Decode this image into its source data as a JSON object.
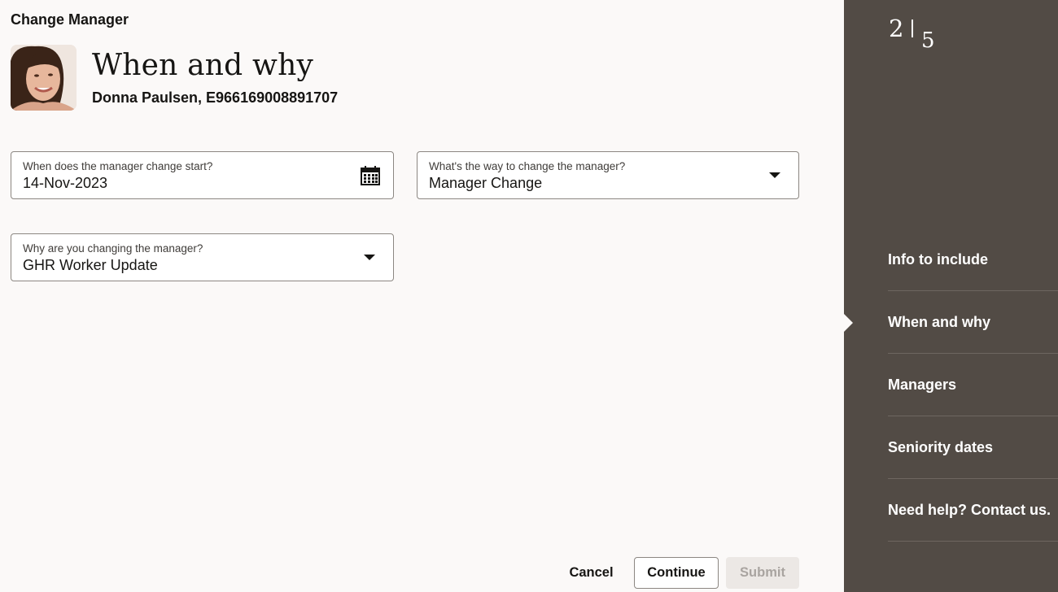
{
  "app": {
    "title": "Change Manager"
  },
  "header": {
    "heading": "When and why",
    "person": "Donna Paulsen, E966169008891707"
  },
  "form": {
    "start_date": {
      "label": "When does the manager change start?",
      "value": "14-Nov-2023",
      "icon": "calendar-icon"
    },
    "change_way": {
      "label": "What's the way to change the manager?",
      "value": "Manager Change",
      "icon": "chevron-down-icon"
    },
    "reason": {
      "label": "Why are you changing the manager?",
      "value": "GHR Worker Update",
      "icon": "chevron-down-icon"
    }
  },
  "actions": {
    "cancel": "Cancel",
    "continue": "Continue",
    "submit": "Submit"
  },
  "progress": {
    "current": "2",
    "total": "5"
  },
  "sidebar": {
    "items": [
      {
        "label": "Info to include"
      },
      {
        "label": "When and why"
      },
      {
        "label": "Managers"
      },
      {
        "label": "Seniority dates"
      },
      {
        "label": "Need help? Contact us."
      }
    ],
    "active_index": 1
  },
  "colors": {
    "sidebar_bg": "#524b45",
    "page_bg": "#fbf9f8",
    "field_border": "#8c8782",
    "submit_disabled_bg": "#ece8e5"
  }
}
